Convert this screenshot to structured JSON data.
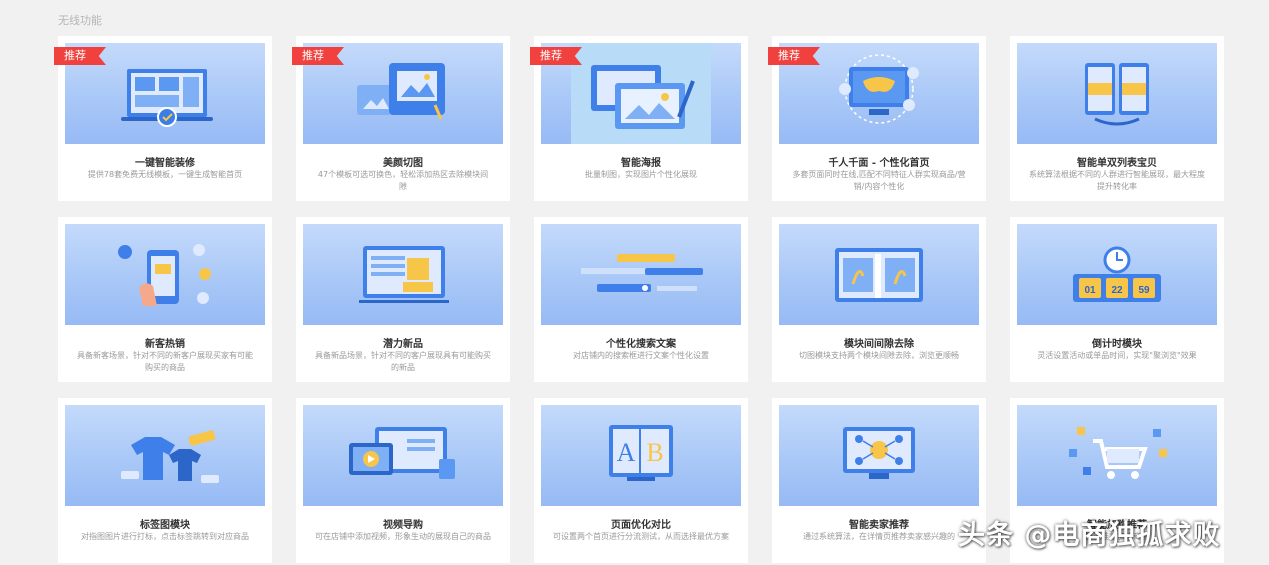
{
  "section_title": "无线功能",
  "badge_label": "推荐",
  "cards": [
    {
      "title": "一键智能装修",
      "desc": "提供78套免费无线模板，一键生成智能首页",
      "badge": true,
      "icon": "laptop-grid-icon"
    },
    {
      "title": "美颜切图",
      "desc": "47个模板可选可换色，轻松添加热区去除模块间隙",
      "badge": true,
      "icon": "image-crop-icon"
    },
    {
      "title": "智能海报",
      "desc": "批量制图，实现图片个性化展现",
      "badge": true,
      "icon": "poster-pen-icon"
    },
    {
      "title": "千人千面 - 个性化首页",
      "desc": "多套页面同时在线,匹配不同特征人群实现商品/营销/内容个性化",
      "badge": true,
      "icon": "mask-monitor-icon"
    },
    {
      "title": "智能单双列表宝贝",
      "desc": "系统算法根据不同的人群进行智能展现，最大程度提升转化率",
      "badge": false,
      "icon": "dual-phone-icon"
    },
    {
      "title": "新客热销",
      "desc": "具备新客场景，针对不同的新客户展现买家有可能购买的商品",
      "badge": false,
      "icon": "phone-hand-icon"
    },
    {
      "title": "潜力新品",
      "desc": "具备新品场景，针对不同的客户展现具有可能购买的新品",
      "badge": false,
      "icon": "new-box-icon"
    },
    {
      "title": "个性化搜索文案",
      "desc": "对店铺内的搜索框进行文案个性化设置",
      "badge": false,
      "icon": "search-bars-icon"
    },
    {
      "title": "模块间间隙去除",
      "desc": "切图模块支持两个模块间隙去除，浏览更顺畅",
      "badge": false,
      "icon": "gap-remove-icon"
    },
    {
      "title": "倒计时模块",
      "desc": "灵活设置活动或单品时间，实现\"聚浏览\"效果",
      "badge": false,
      "icon": "countdown-clock-icon",
      "digits": [
        "01",
        "22",
        "59"
      ]
    },
    {
      "title": "标签图模块",
      "desc": "对指图图片进行打标，点击标签跳转到对应商品",
      "badge": false,
      "icon": "clothes-tag-icon"
    },
    {
      "title": "视频导购",
      "desc": "可在店铺中添加视频，形象生动的展现自己的商品",
      "badge": false,
      "icon": "video-play-icon"
    },
    {
      "title": "页面优化对比",
      "desc": "可设置两个首页进行分流测试，从而选择最优方案",
      "badge": false,
      "icon": "ab-test-icon",
      "letters": [
        "A",
        "B"
      ]
    },
    {
      "title": "智能卖家推荐",
      "desc": "通过系统算法，在详情页推荐卖家感兴趣的",
      "badge": false,
      "icon": "recommend-network-icon"
    },
    {
      "title": "智能加购推荐",
      "desc": "智能推荐加购商品",
      "badge": false,
      "icon": "shopping-cart-icon"
    }
  ],
  "watermark": "头条 @电商独孤求败",
  "colors": {
    "accent": "#f0413e",
    "thumb_top": "#c4dafb",
    "thumb_bottom": "#97baf5",
    "card_bg": "#ffffff",
    "page_bg": "#f1f1f1"
  }
}
